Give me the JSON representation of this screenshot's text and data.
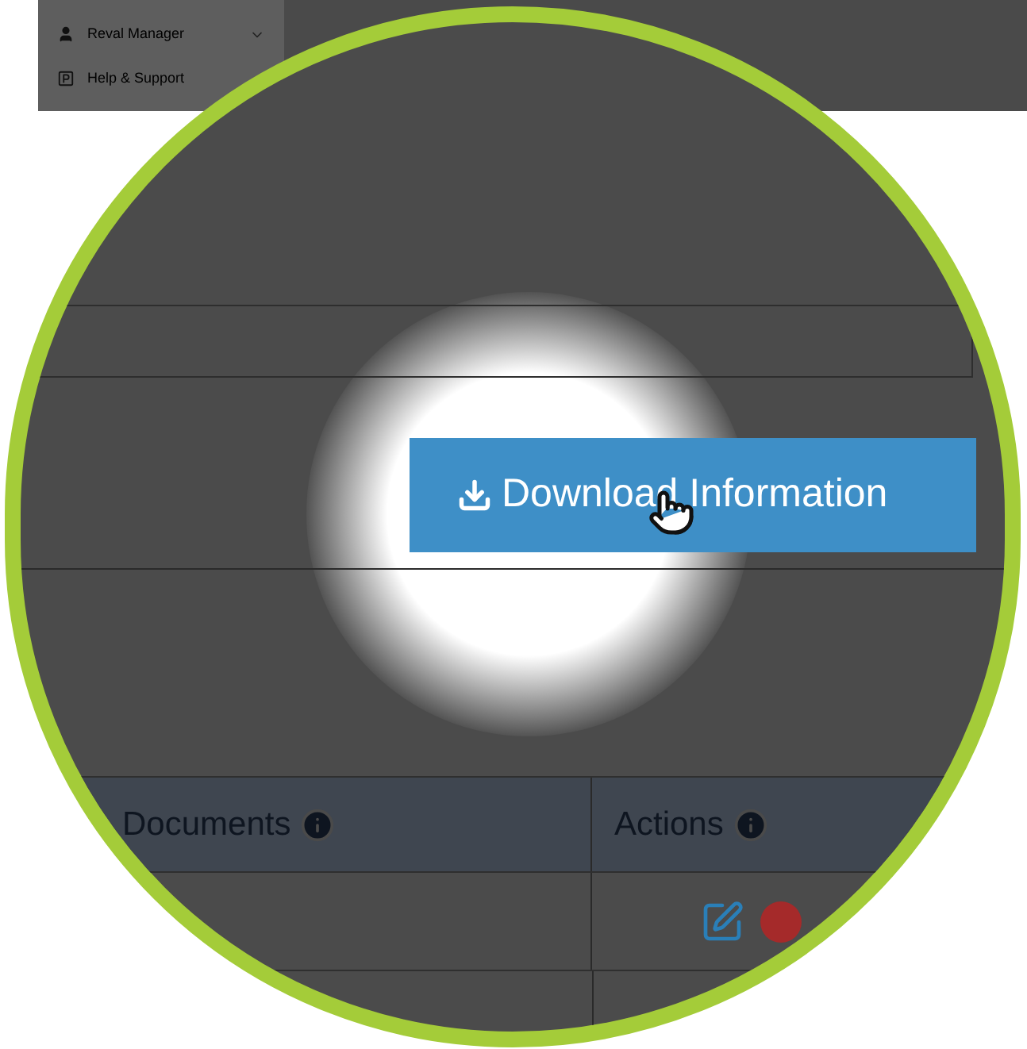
{
  "sidebar": {
    "items": [
      {
        "label": "Reval Manager",
        "expandable": true
      },
      {
        "label": "Help & Support",
        "expandable": false
      }
    ]
  },
  "download_button": {
    "label": "Download Information"
  },
  "table": {
    "columns": [
      {
        "label": "Documents"
      },
      {
        "label": "Actions"
      }
    ]
  }
}
